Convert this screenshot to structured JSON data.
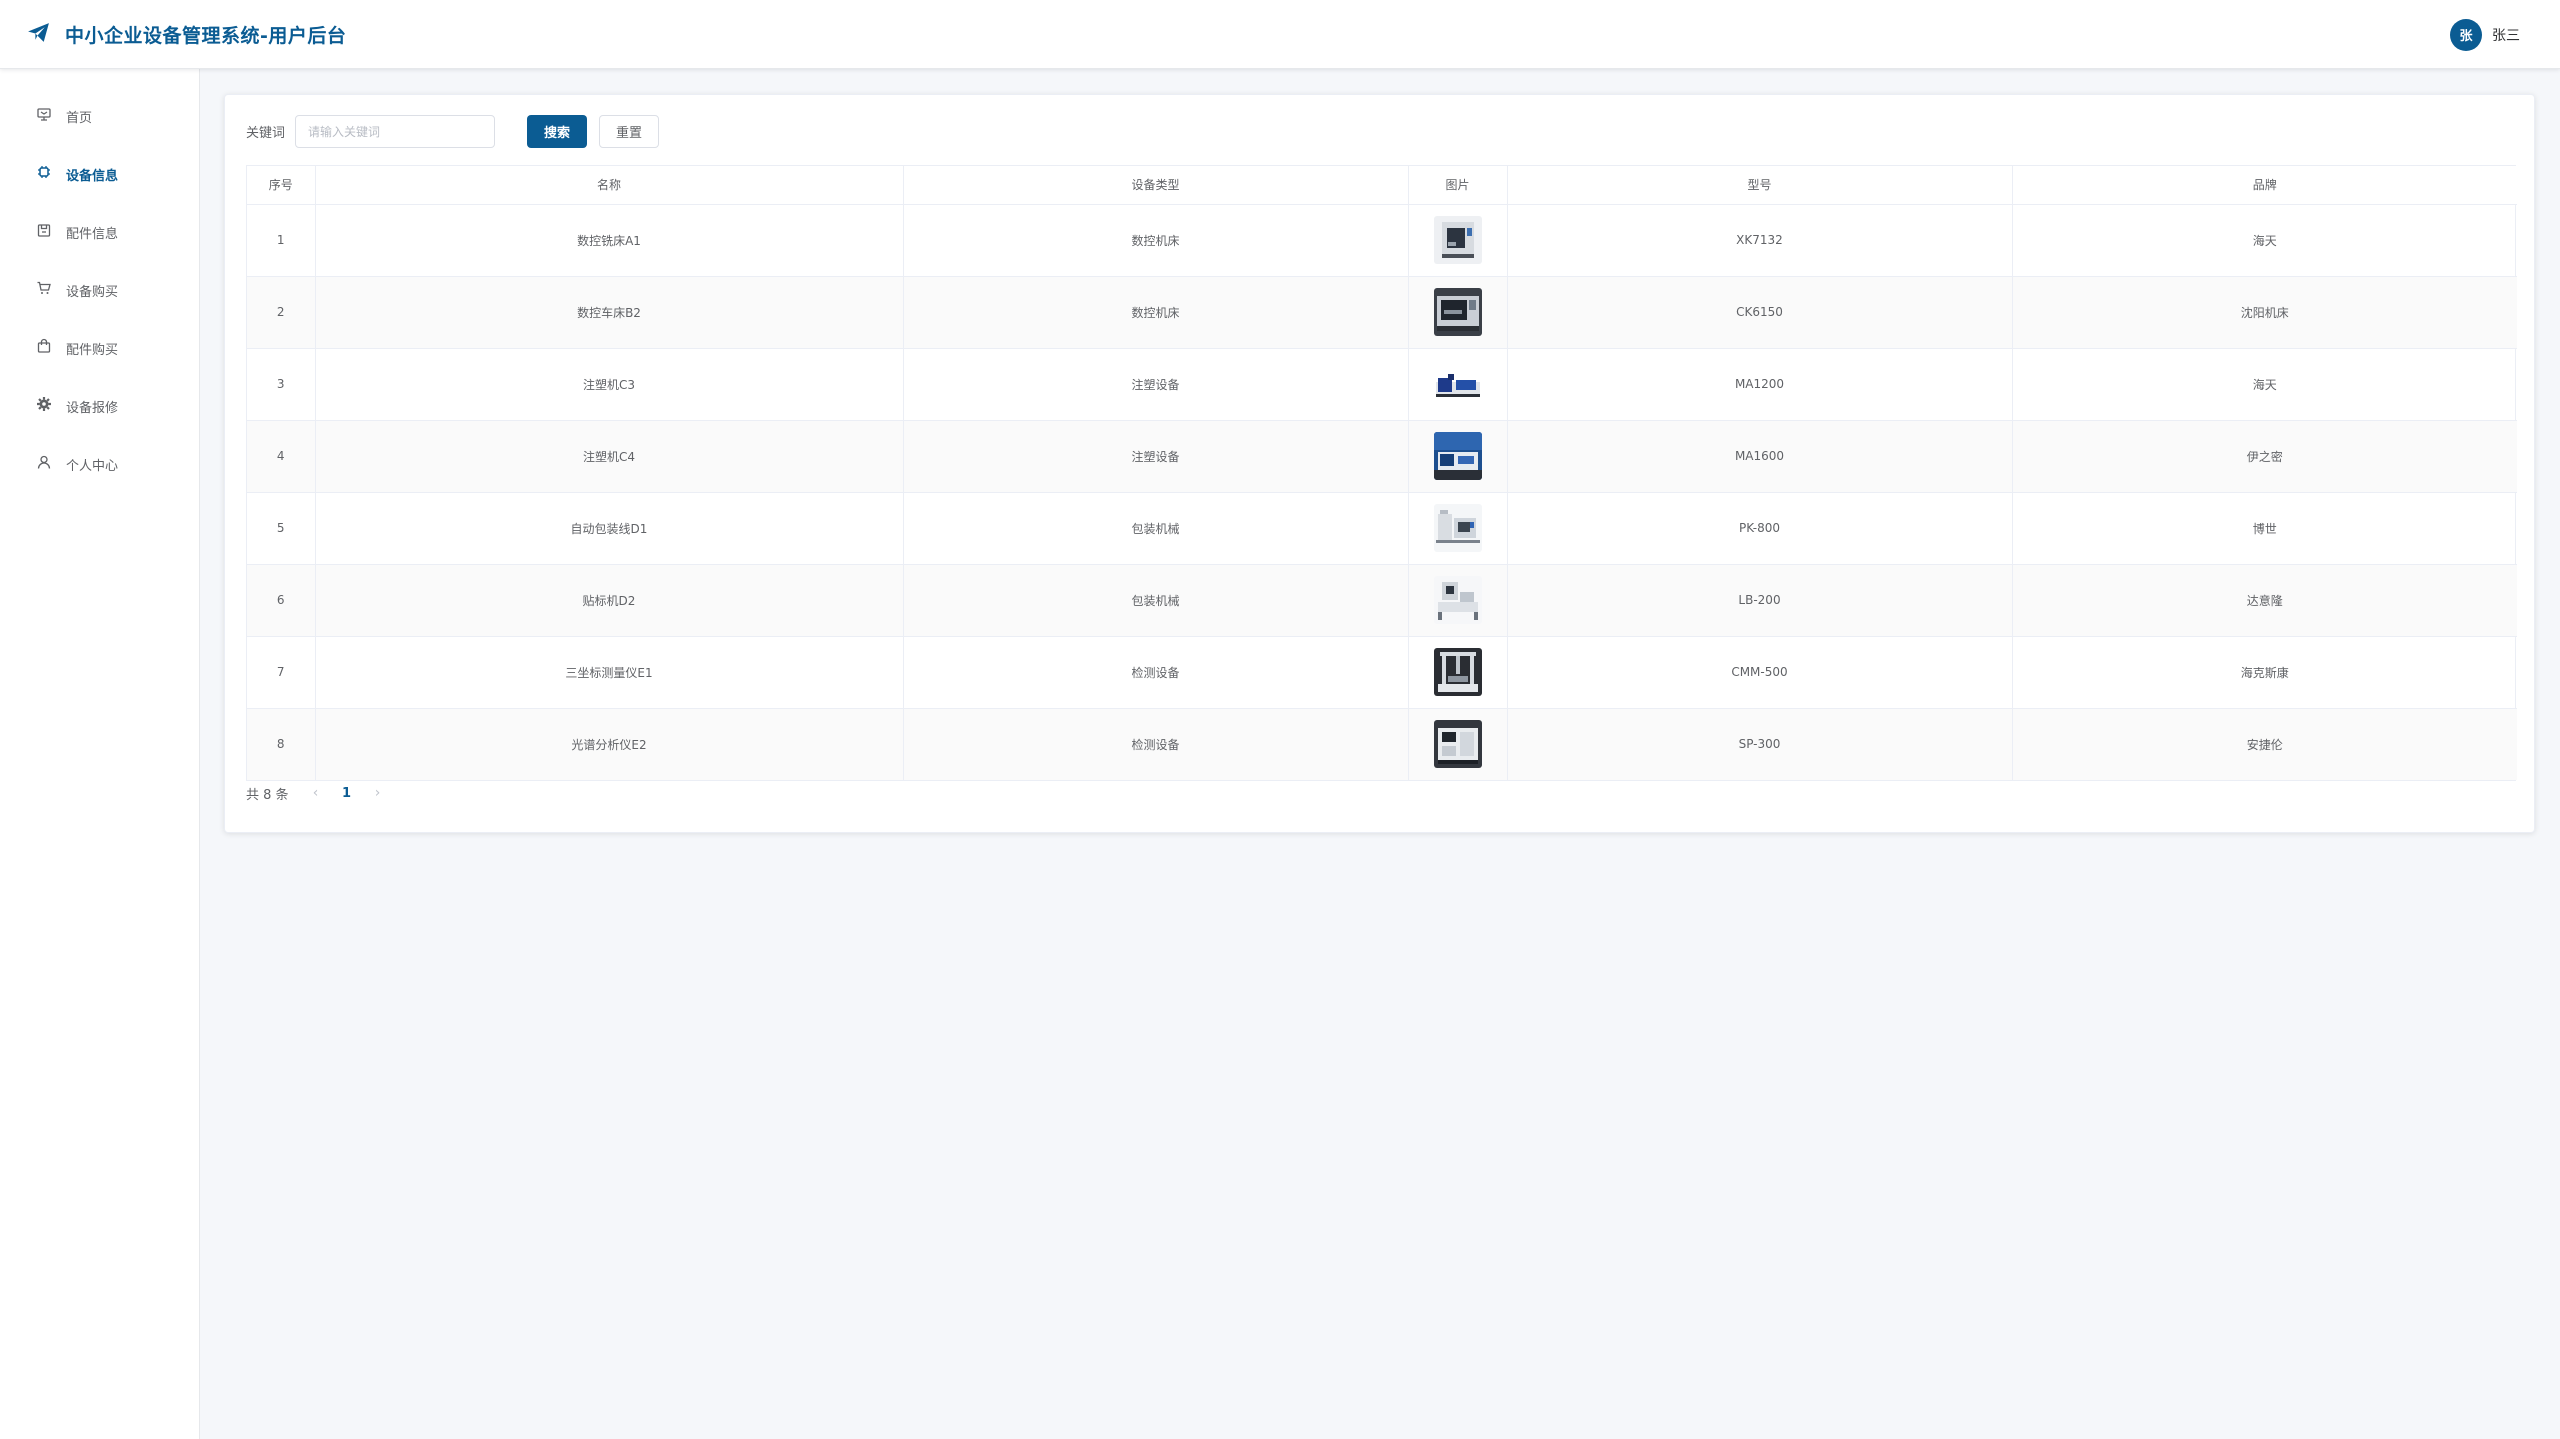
{
  "header": {
    "title": "中小企业设备管理系统-用户后台",
    "logo_icon": "paper-plane-icon",
    "user": {
      "avatar_text": "张",
      "name": "张三"
    }
  },
  "colors": {
    "primary": "#0b5c93",
    "stripe": "#fafafa",
    "border": "#ebeef5"
  },
  "sidebar": {
    "items": [
      {
        "label": "首页",
        "icon": "home-icon",
        "active": false
      },
      {
        "label": "设备信息",
        "icon": "chip-icon",
        "active": true
      },
      {
        "label": "配件信息",
        "icon": "box-icon",
        "active": false
      },
      {
        "label": "设备购买",
        "icon": "cart-icon",
        "active": false
      },
      {
        "label": "配件购买",
        "icon": "bag-icon",
        "active": false
      },
      {
        "label": "设备报修",
        "icon": "gear-icon",
        "active": false
      },
      {
        "label": "个人中心",
        "icon": "user-icon",
        "active": false
      }
    ]
  },
  "search": {
    "label": "关键词",
    "placeholder": "请输入关键词",
    "value": "",
    "search_label": "搜索",
    "reset_label": "重置"
  },
  "table": {
    "columns": [
      "序号",
      "名称",
      "设备类型",
      "图片",
      "型号",
      "品牌"
    ],
    "rows": [
      {
        "index": "1",
        "name": "数控铣床A1",
        "type": "数控机床",
        "image": "cnc-mill-thumbnail",
        "model": "XK7132",
        "brand": "海天"
      },
      {
        "index": "2",
        "name": "数控车床B2",
        "type": "数控机床",
        "image": "cnc-lathe-thumbnail",
        "model": "CK6150",
        "brand": "沈阳机床"
      },
      {
        "index": "3",
        "name": "注塑机C3",
        "type": "注塑设备",
        "image": "injection-molder-thumbnail",
        "model": "MA1200",
        "brand": "海天"
      },
      {
        "index": "4",
        "name": "注塑机C4",
        "type": "注塑设备",
        "image": "injection-molder-thumbnail",
        "model": "MA1600",
        "brand": "伊之密"
      },
      {
        "index": "5",
        "name": "自动包装线D1",
        "type": "包装机械",
        "image": "packaging-line-thumbnail",
        "model": "PK-800",
        "brand": "博世"
      },
      {
        "index": "6",
        "name": "贴标机D2",
        "type": "包装机械",
        "image": "labeler-thumbnail",
        "model": "LB-200",
        "brand": "达意隆"
      },
      {
        "index": "7",
        "name": "三坐标测量仪E1",
        "type": "检测设备",
        "image": "cmm-thumbnail",
        "model": "CMM-500",
        "brand": "海克斯康"
      },
      {
        "index": "8",
        "name": "光谱分析仪E2",
        "type": "检测设备",
        "image": "spectrometer-thumbnail",
        "model": "SP-300",
        "brand": "安捷伦"
      }
    ]
  },
  "pagination": {
    "total_text": "共 8 条",
    "current_page": "1",
    "prev_icon": "chevron-left-icon",
    "next_icon": "chevron-right-icon"
  }
}
